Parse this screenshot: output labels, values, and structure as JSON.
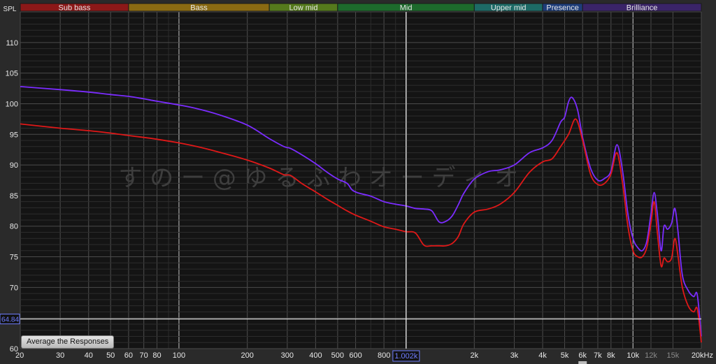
{
  "ui": {
    "average_button": "Average the Responses",
    "watermark": "す の ー @ ゆ る ふ わ オ ー デ ィ オ",
    "cursor_freq_label": "1.002k",
    "cursor_spl_label": "64.84"
  },
  "colors": {
    "background": "#141414",
    "major_grid": "#4a4a4a",
    "minor_grid": "#2c2c2c",
    "cursor": "#e6e6e6",
    "label_highlight": "#6f7dff"
  },
  "bands": [
    {
      "label": "Sub bass",
      "from": 20,
      "to": 60,
      "color": "#8c1818"
    },
    {
      "label": "Bass",
      "from": 60,
      "to": 250,
      "color": "#8a6a12"
    },
    {
      "label": "Low mid",
      "from": 250,
      "to": 500,
      "color": "#557a1c"
    },
    {
      "label": "Mid",
      "from": 500,
      "to": 2000,
      "color": "#1d6a2c"
    },
    {
      "label": "Upper mid",
      "from": 2000,
      "to": 4000,
      "color": "#1d6a66"
    },
    {
      "label": "Presence",
      "from": 4000,
      "to": 6000,
      "color": "#1e3d7a"
    },
    {
      "label": "Brilliance",
      "from": 6000,
      "to": 20000,
      "color": "#3a2468"
    }
  ],
  "chart_data": {
    "type": "line",
    "ylabel": "SPL",
    "xlim": [
      20,
      20000
    ],
    "ylim": [
      60,
      115
    ],
    "x_scale": "log",
    "grid": true,
    "y_ticks": [
      60,
      65,
      70,
      75,
      80,
      85,
      90,
      95,
      100,
      105,
      110
    ],
    "x_ticks": [
      {
        "v": 20,
        "label": "20"
      },
      {
        "v": 30,
        "label": "30"
      },
      {
        "v": 40,
        "label": "40"
      },
      {
        "v": 50,
        "label": "50"
      },
      {
        "v": 60,
        "label": "60"
      },
      {
        "v": 70,
        "label": "70"
      },
      {
        "v": 80,
        "label": "80"
      },
      {
        "v": 100,
        "label": "100"
      },
      {
        "v": 200,
        "label": "200"
      },
      {
        "v": 300,
        "label": "300"
      },
      {
        "v": 400,
        "label": "400"
      },
      {
        "v": 500,
        "label": "500"
      },
      {
        "v": 600,
        "label": "600"
      },
      {
        "v": 800,
        "label": "800"
      },
      {
        "v": 2000,
        "label": "2k"
      },
      {
        "v": 3000,
        "label": "3k"
      },
      {
        "v": 4000,
        "label": "4k"
      },
      {
        "v": 5000,
        "label": "5k"
      },
      {
        "v": 6000,
        "label": "6k"
      },
      {
        "v": 7000,
        "label": "7k"
      },
      {
        "v": 8000,
        "label": "8k"
      },
      {
        "v": 10000,
        "label": "10k"
      },
      {
        "v": 12000,
        "label": "12k"
      },
      {
        "v": 15000,
        "label": "15k"
      },
      {
        "v": 20000,
        "label": "20kHz"
      }
    ],
    "x_highlight": [
      100,
      1000,
      10000
    ],
    "cursor": {
      "x": 1002,
      "y": 64.84
    },
    "series": [
      {
        "color": "#7b2cff",
        "points": [
          [
            20,
            102.8
          ],
          [
            30,
            102.3
          ],
          [
            40,
            101.9
          ],
          [
            50,
            101.5
          ],
          [
            60,
            101.2
          ],
          [
            70,
            100.8
          ],
          [
            80,
            100.4
          ],
          [
            100,
            99.8
          ],
          [
            120,
            99.2
          ],
          [
            150,
            98.2
          ],
          [
            200,
            96.5
          ],
          [
            250,
            94.3
          ],
          [
            290,
            93.0
          ],
          [
            310,
            92.7
          ],
          [
            350,
            91.6
          ],
          [
            400,
            90.2
          ],
          [
            450,
            88.8
          ],
          [
            500,
            87.7
          ],
          [
            550,
            87.0
          ],
          [
            580,
            85.9
          ],
          [
            620,
            85.4
          ],
          [
            700,
            84.9
          ],
          [
            800,
            84.0
          ],
          [
            900,
            83.6
          ],
          [
            1000,
            83.3
          ],
          [
            1100,
            82.9
          ],
          [
            1200,
            82.8
          ],
          [
            1300,
            82.5
          ],
          [
            1400,
            80.7
          ],
          [
            1500,
            80.8
          ],
          [
            1600,
            81.7
          ],
          [
            1700,
            83.5
          ],
          [
            1800,
            85.4
          ],
          [
            2000,
            87.7
          ],
          [
            2300,
            88.9
          ],
          [
            2600,
            89.2
          ],
          [
            3000,
            90.0
          ],
          [
            3500,
            92.0
          ],
          [
            4000,
            92.8
          ],
          [
            4400,
            94.0
          ],
          [
            4800,
            97.0
          ],
          [
            5000,
            97.8
          ],
          [
            5200,
            100.3
          ],
          [
            5400,
            101.0
          ],
          [
            5700,
            99.0
          ],
          [
            6000,
            94.5
          ],
          [
            6500,
            89.5
          ],
          [
            7000,
            87.5
          ],
          [
            7500,
            87.8
          ],
          [
            8000,
            89.0
          ],
          [
            8500,
            93.3
          ],
          [
            9000,
            89.0
          ],
          [
            9500,
            82.0
          ],
          [
            10000,
            78.0
          ],
          [
            10500,
            76.5
          ],
          [
            11000,
            76.0
          ],
          [
            11500,
            77.5
          ],
          [
            12000,
            82.0
          ],
          [
            12400,
            85.5
          ],
          [
            12800,
            82.0
          ],
          [
            13300,
            76.0
          ],
          [
            13700,
            80.0
          ],
          [
            14200,
            79.5
          ],
          [
            14800,
            80.5
          ],
          [
            15300,
            82.9
          ],
          [
            15800,
            79.0
          ],
          [
            16500,
            72.0
          ],
          [
            17500,
            69.5
          ],
          [
            18500,
            68.5
          ],
          [
            19200,
            68.8
          ],
          [
            20000,
            62.0
          ]
        ]
      },
      {
        "color": "#e01818",
        "points": [
          [
            20,
            96.7
          ],
          [
            30,
            96.0
          ],
          [
            40,
            95.6
          ],
          [
            50,
            95.2
          ],
          [
            60,
            94.8
          ],
          [
            70,
            94.5
          ],
          [
            80,
            94.2
          ],
          [
            100,
            93.6
          ],
          [
            120,
            93.0
          ],
          [
            150,
            92.1
          ],
          [
            200,
            90.8
          ],
          [
            250,
            89.5
          ],
          [
            290,
            88.4
          ],
          [
            310,
            88.3
          ],
          [
            350,
            86.9
          ],
          [
            400,
            85.6
          ],
          [
            450,
            84.4
          ],
          [
            500,
            83.4
          ],
          [
            550,
            82.5
          ],
          [
            600,
            81.8
          ],
          [
            700,
            80.8
          ],
          [
            800,
            79.9
          ],
          [
            900,
            79.5
          ],
          [
            1000,
            79.1
          ],
          [
            1100,
            78.9
          ],
          [
            1200,
            76.9
          ],
          [
            1300,
            76.8
          ],
          [
            1400,
            76.8
          ],
          [
            1500,
            76.8
          ],
          [
            1600,
            77.2
          ],
          [
            1700,
            78.3
          ],
          [
            1800,
            80.4
          ],
          [
            2000,
            82.3
          ],
          [
            2300,
            82.8
          ],
          [
            2600,
            83.6
          ],
          [
            3000,
            85.5
          ],
          [
            3500,
            88.8
          ],
          [
            4000,
            90.5
          ],
          [
            4400,
            91.0
          ],
          [
            4800,
            93.0
          ],
          [
            5200,
            95.0
          ],
          [
            5600,
            97.5
          ],
          [
            6000,
            94.0
          ],
          [
            6500,
            88.5
          ],
          [
            7000,
            86.8
          ],
          [
            7500,
            87.0
          ],
          [
            8000,
            88.5
          ],
          [
            8500,
            92.0
          ],
          [
            9000,
            87.0
          ],
          [
            9500,
            80.0
          ],
          [
            10000,
            76.0
          ],
          [
            10500,
            75.0
          ],
          [
            11000,
            75.0
          ],
          [
            11500,
            76.5
          ],
          [
            12000,
            80.5
          ],
          [
            12400,
            84.0
          ],
          [
            12800,
            79.0
          ],
          [
            13300,
            73.5
          ],
          [
            13700,
            74.8
          ],
          [
            14200,
            74.2
          ],
          [
            14800,
            74.8
          ],
          [
            15300,
            78.0
          ],
          [
            15800,
            75.0
          ],
          [
            16500,
            70.0
          ],
          [
            17500,
            67.0
          ],
          [
            18500,
            66.0
          ],
          [
            19200,
            66.5
          ],
          [
            20000,
            61.0
          ]
        ]
      }
    ]
  }
}
